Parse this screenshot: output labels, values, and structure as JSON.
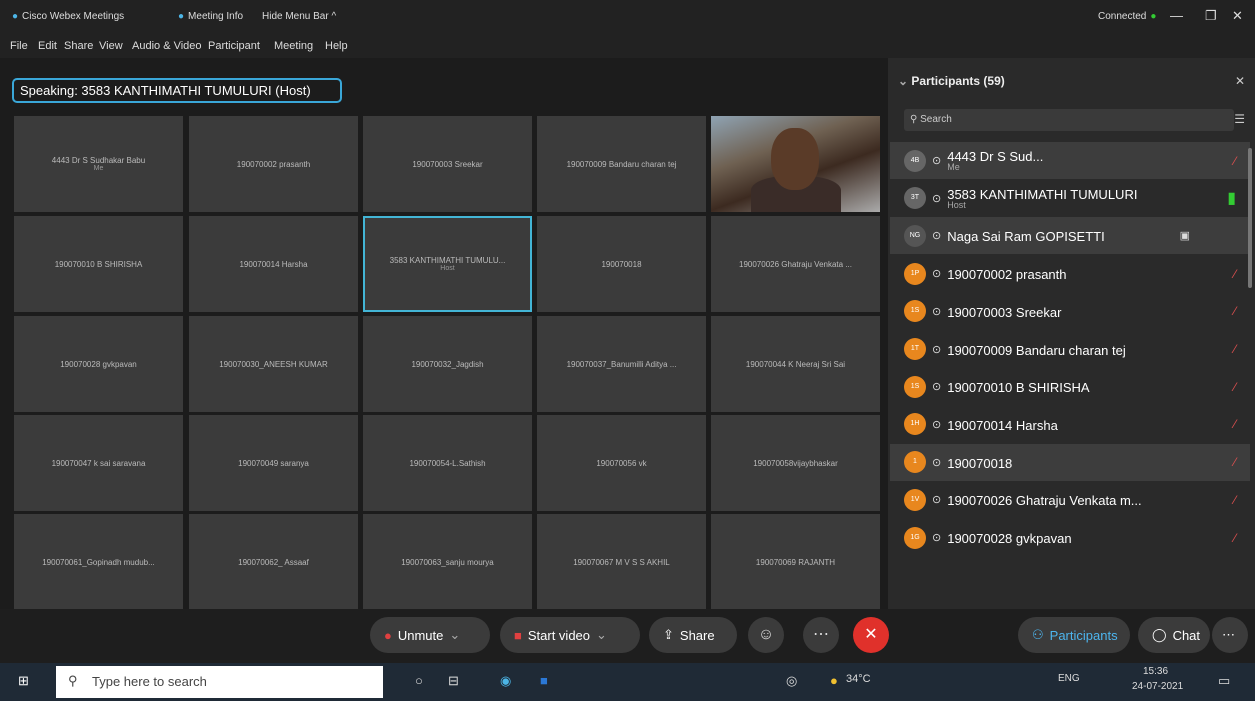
{
  "titlebar": {
    "app": "Cisco Webex Meetings",
    "info": "Meeting Info",
    "hide": "Hide Menu Bar ^",
    "status": "Connected"
  },
  "menu": [
    "File",
    "Edit",
    "Share",
    "View",
    "Audio & Video",
    "Participant",
    "Meeting",
    "Help"
  ],
  "speaking": "Speaking: 3583 KANTHIMATHI TUMULURI (Host)",
  "tiles": [
    {
      "name": "4443 Dr S Sudhakar Babu",
      "sub": "Me"
    },
    {
      "name": "190070002 prasanth",
      "sub": ""
    },
    {
      "name": "190070003 Sreekar",
      "sub": ""
    },
    {
      "name": "190070009 Bandaru charan tej",
      "sub": ""
    },
    {
      "name": "",
      "sub": ""
    },
    {
      "name": "190070010 B SHIRISHA",
      "sub": ""
    },
    {
      "name": "190070014 Harsha",
      "sub": ""
    },
    {
      "name": "3583 KANTHIMATHI TUMULU...",
      "sub": "Host"
    },
    {
      "name": "190070018",
      "sub": ""
    },
    {
      "name": "190070026 Ghatraju Venkata ...",
      "sub": ""
    },
    {
      "name": "190070028 gvkpavan",
      "sub": ""
    },
    {
      "name": "190070030_ANEESH KUMAR",
      "sub": ""
    },
    {
      "name": "190070032_Jagdish",
      "sub": ""
    },
    {
      "name": "190070037_Banumilli Aditya ...",
      "sub": ""
    },
    {
      "name": "190070044 K Neeraj Sri Sai",
      "sub": ""
    },
    {
      "name": "190070047 k sai saravana",
      "sub": ""
    },
    {
      "name": "190070049 saranya",
      "sub": ""
    },
    {
      "name": "190070054-L.Sathish",
      "sub": ""
    },
    {
      "name": "190070056 vk",
      "sub": ""
    },
    {
      "name": "190070058vijaybhaskar",
      "sub": ""
    },
    {
      "name": "190070061_Gopinadh mudub...",
      "sub": ""
    },
    {
      "name": "190070062_ Assaaf",
      "sub": ""
    },
    {
      "name": "190070063_sanju mourya",
      "sub": ""
    },
    {
      "name": "190070067 M V S S AKHIL",
      "sub": ""
    },
    {
      "name": "190070069 RAJANTH",
      "sub": ""
    }
  ],
  "panel": {
    "title": "Participants (59)",
    "search_placeholder": "Search"
  },
  "participants": [
    {
      "initials": "4B",
      "name": "4443 Dr S Sud...",
      "role": "Me"
    },
    {
      "initials": "3T",
      "name": "3583 KANTHIMATHI TUMULURI",
      "role": "Host"
    },
    {
      "initials": "NG",
      "name": "Naga Sai Ram GOPISETTI",
      "role": ""
    },
    {
      "initials": "1P",
      "name": "190070002 prasanth",
      "role": ""
    },
    {
      "initials": "1S",
      "name": "190070003 Sreekar",
      "role": ""
    },
    {
      "initials": "1T",
      "name": "190070009 Bandaru charan tej",
      "role": ""
    },
    {
      "initials": "1S",
      "name": "190070010 B SHIRISHA",
      "role": ""
    },
    {
      "initials": "1H",
      "name": "190070014 Harsha",
      "role": ""
    },
    {
      "initials": "1",
      "name": "190070018",
      "role": ""
    },
    {
      "initials": "1V",
      "name": "190070026 Ghatraju Venkata m...",
      "role": ""
    },
    {
      "initials": "1G",
      "name": "190070028 gvkpavan",
      "role": ""
    }
  ],
  "controls": {
    "unmute": "Unmute",
    "start_video": "Start video",
    "share": "Share",
    "participants": "Participants",
    "chat": "Chat"
  },
  "taskbar": {
    "search": "Type here to search",
    "temp": "34°C",
    "lang": "ENG",
    "time": "15:36",
    "date": "24-07-2021"
  }
}
